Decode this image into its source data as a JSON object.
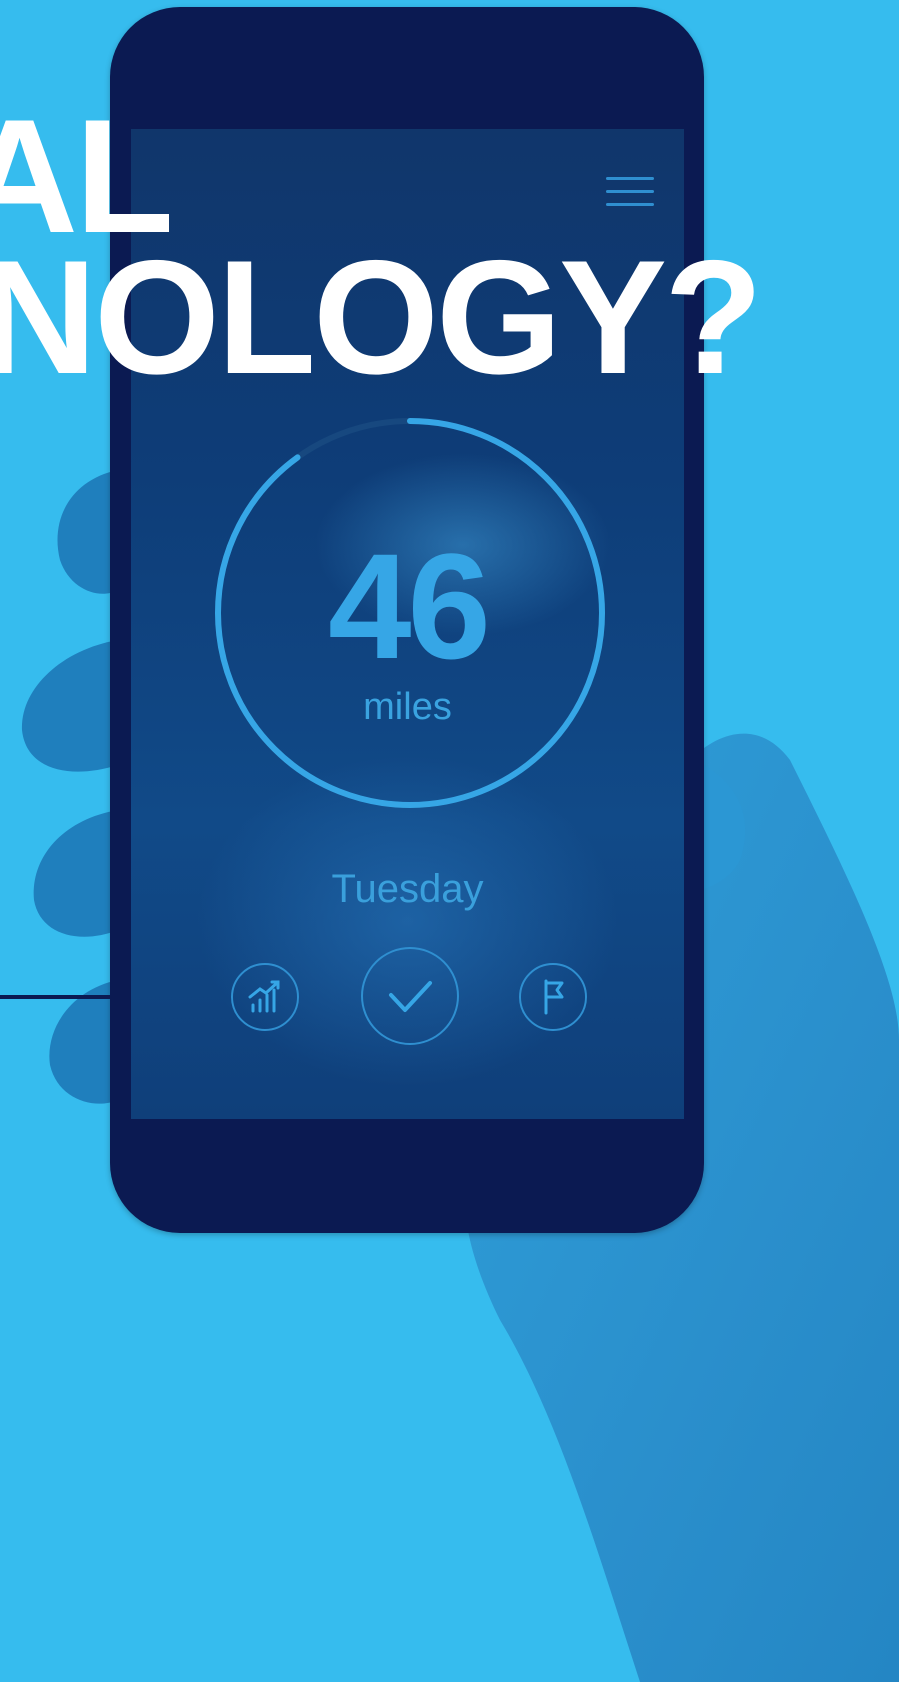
{
  "headline": {
    "line1": "AL",
    "line2": "NOLOGY?"
  },
  "app": {
    "distance_value": "46",
    "distance_unit": "miles",
    "day": "Tuesday",
    "progress_fraction": 0.9,
    "icons": {
      "menu": "menu-icon",
      "stats": "bar-chart-icon",
      "confirm": "checkmark-icon",
      "goal": "flag-icon"
    }
  },
  "colors": {
    "background": "#36bcee",
    "phone_body": "#0b1a52",
    "accent": "#36a6e6",
    "headline": "#ffffff"
  }
}
